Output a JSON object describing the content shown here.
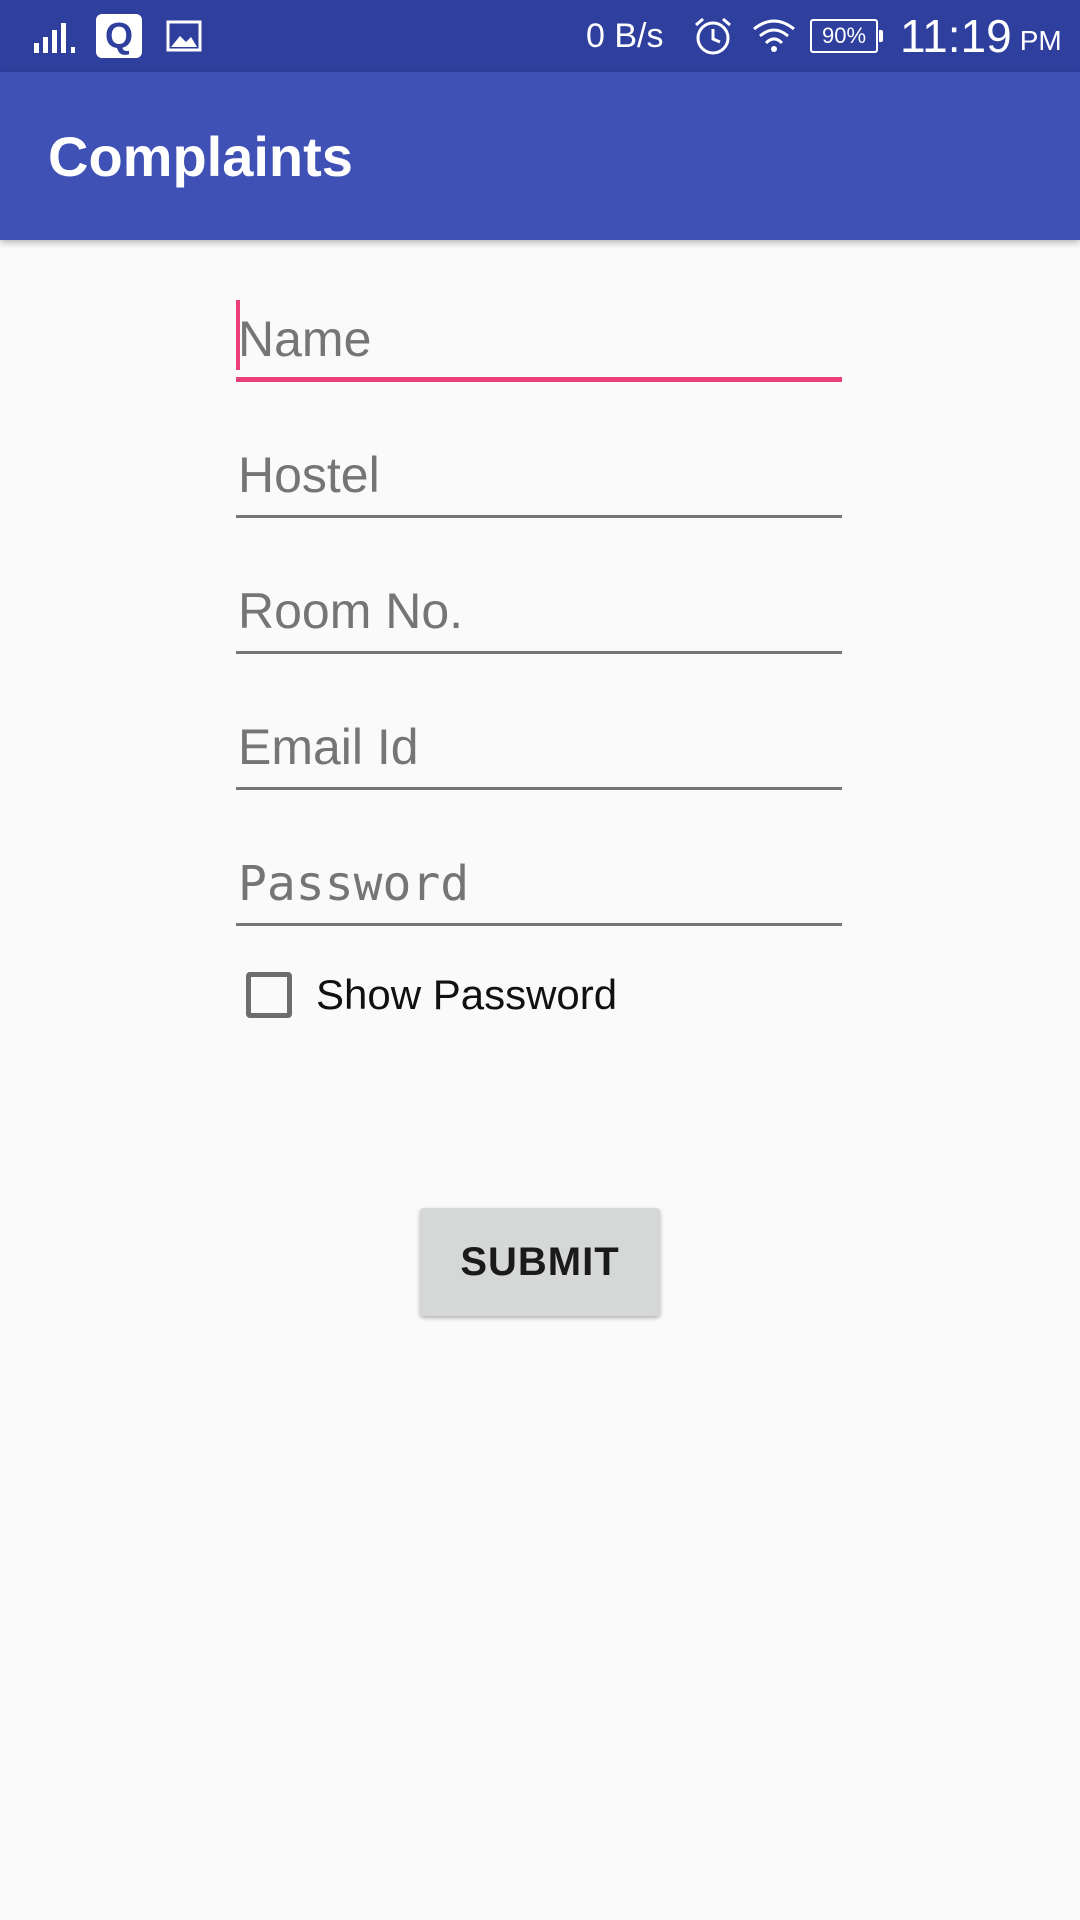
{
  "status_bar": {
    "network_speed": "0 B/s",
    "battery_percent": "90%",
    "time": "11:19",
    "ampm": "PM",
    "q_app_letter": "Q",
    "icons": [
      "signal-icon",
      "q-app-icon",
      "gallery-icon",
      "alarm-icon",
      "wifi-icon",
      "battery-icon"
    ]
  },
  "app_bar": {
    "title": "Complaints",
    "color": "#3f51b5"
  },
  "form": {
    "name_placeholder": "Name",
    "hostel_placeholder": "Hostel",
    "room_placeholder": "Room No.",
    "email_placeholder": "Email Id",
    "password_placeholder": "Password",
    "show_password_label": "Show Password",
    "show_password_checked": false,
    "focused_field": "name",
    "accent_color": "#ec407a"
  },
  "submit": {
    "label": "SUBMIT"
  }
}
